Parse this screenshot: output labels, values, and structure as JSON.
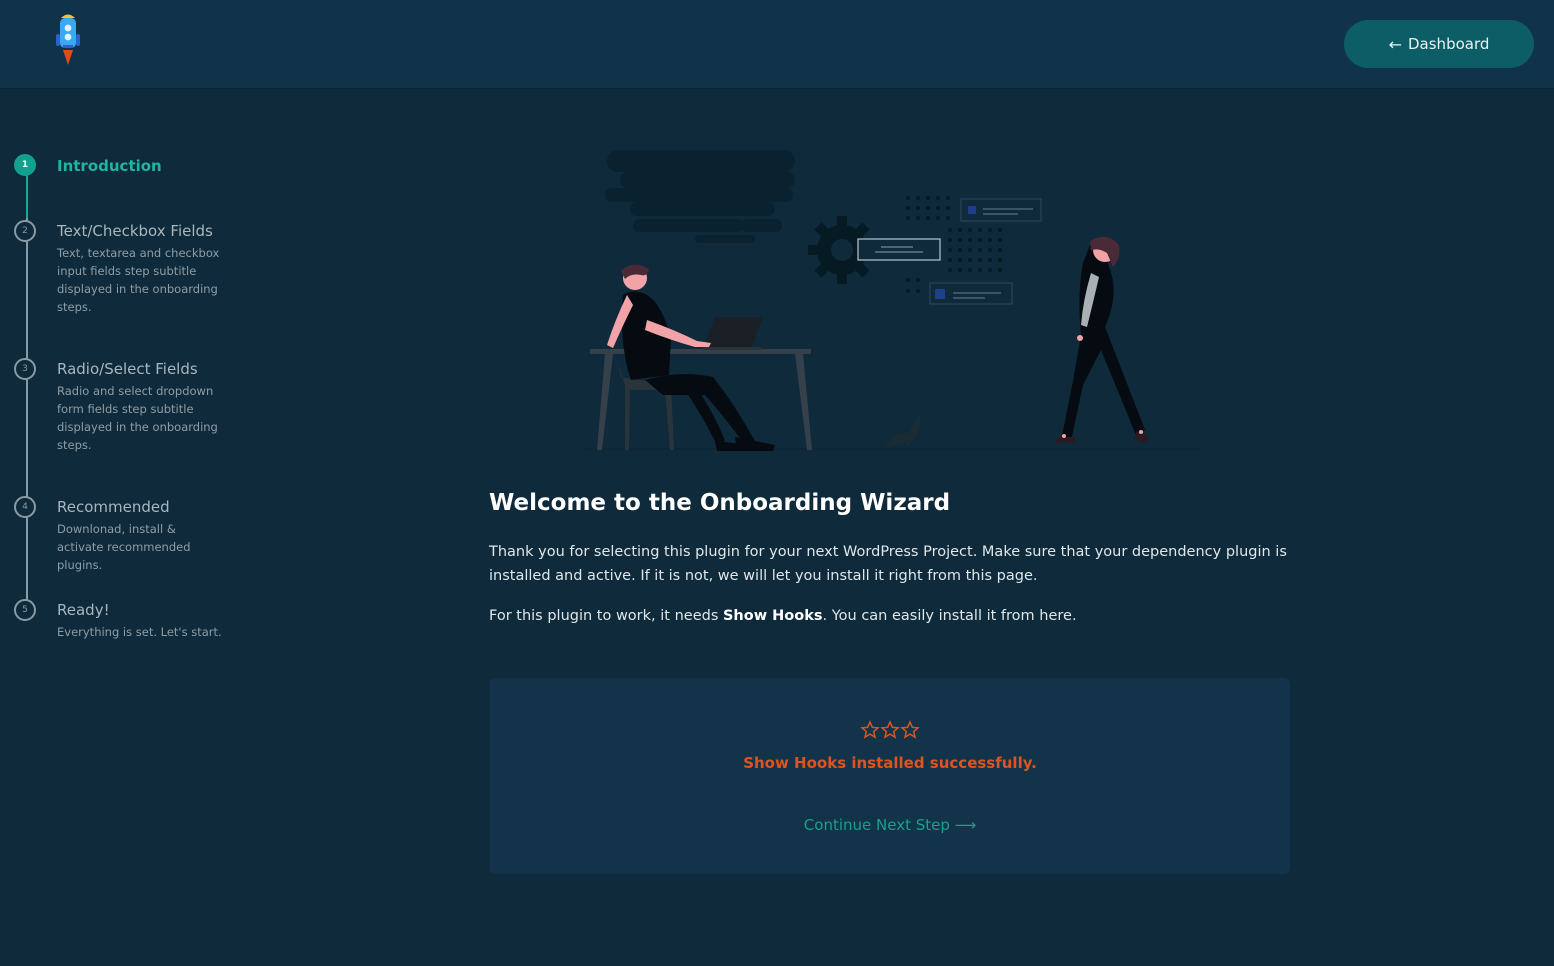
{
  "header": {
    "logo_icon": "rocket-icon",
    "dashboard_button": {
      "arrow": "←",
      "label": "Dashboard"
    }
  },
  "steps": [
    {
      "number": "1",
      "title": "Introduction",
      "subtitle": "",
      "active": true
    },
    {
      "number": "2",
      "title": "Text/Checkbox Fields",
      "subtitle": "Text, textarea and checkbox input fields step subtitle displayed in the onboarding steps."
    },
    {
      "number": "3",
      "title": "Radio/Select Fields",
      "subtitle": "Radio and select dropdown form fields step subtitle displayed in the onboarding steps."
    },
    {
      "number": "4",
      "title": "Recommended",
      "subtitle": "Downlonad, install & activate recommended plugins."
    },
    {
      "number": "5",
      "title": "Ready!",
      "subtitle": "Everything is set. Let's start."
    }
  ],
  "main": {
    "heading": "Welcome to the Onboarding Wizard",
    "paragraph1": "Thank you for selecting this plugin for your next WordPress Project. Make sure that your dependency plugin is installed and active. If it is not, we will let you install it right from this page.",
    "paragraph2_prefix": "For this plugin to work, it needs ",
    "paragraph2_bold": "Show Hooks",
    "paragraph2_suffix": ". You can easily install it from here.",
    "card": {
      "stars_icon": "stars-icon",
      "success_text": "Show Hooks installed successfully.",
      "continue_label": "Continue Next Step",
      "continue_arrow": "⟶"
    }
  },
  "colors": {
    "background": "#0e2a3b",
    "topbar": "#10334a",
    "accent": "#13a08e",
    "success": "#e0531f",
    "button": "#0d5d66"
  }
}
